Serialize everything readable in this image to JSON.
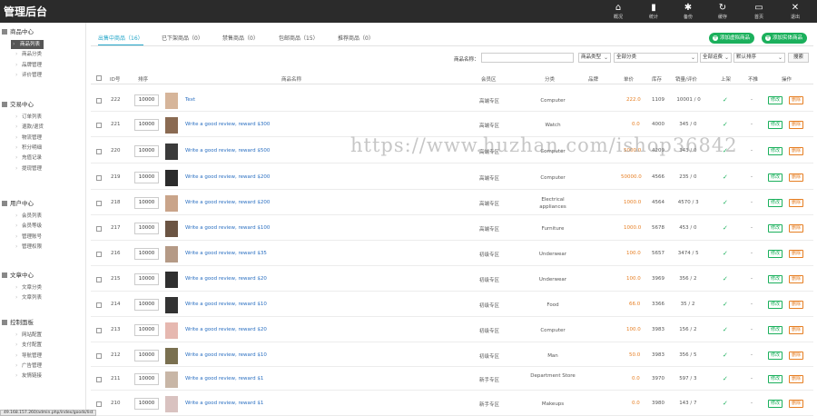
{
  "header": {
    "title": "管理后台",
    "nav": [
      {
        "icon": "home-icon",
        "glyph": "⌂",
        "label": "概况"
      },
      {
        "icon": "bar-chart-icon",
        "glyph": "▮",
        "label": "统计"
      },
      {
        "icon": "gear-icon",
        "glyph": "✱",
        "label": "备份"
      },
      {
        "icon": "refresh-icon",
        "glyph": "↻",
        "label": "缓存"
      },
      {
        "icon": "monitor-icon",
        "glyph": "▭",
        "label": "首页"
      },
      {
        "icon": "close-icon",
        "glyph": "✕",
        "label": "退出"
      }
    ]
  },
  "sidebar": {
    "sections": [
      {
        "title": "商品中心",
        "items": [
          "商品列表",
          "商品分类",
          "品牌管理",
          "评价管理"
        ]
      },
      {
        "title": "交易中心",
        "items": [
          "订单列表",
          "退款/退货",
          "物流管理",
          "积分明细",
          "充值记录",
          "提现管理"
        ]
      },
      {
        "title": "用户中心",
        "items": [
          "会员列表",
          "会员等级",
          "管理账号",
          "管理权限"
        ]
      },
      {
        "title": "文章中心",
        "items": [
          "文章分类",
          "文章列表"
        ]
      },
      {
        "title": "控制面板",
        "items": [
          "网站配置",
          "支付配置",
          "导航管理",
          "广告管理",
          "友情链接"
        ]
      }
    ],
    "active_item": "商品列表"
  },
  "tabs": [
    "出售中商品（16）",
    "已下架商品（0）",
    "禁售商品（0）",
    "包邮商品（15）",
    "推荐商品（0）"
  ],
  "buttons": {
    "add_virtual": "添加虚拟商品",
    "add_physical": "添加实体商品"
  },
  "filters": {
    "name_label": "商品名称：",
    "name_value": "",
    "type_select": "商品类型",
    "category_select": "全部分类",
    "ship_select": "全部运费",
    "sort_select": "默认排序",
    "search_button": "搜索"
  },
  "table": {
    "columns": [
      "ID号",
      "排序",
      "商品名称",
      "会员区",
      "分类",
      "品牌",
      "单价",
      "库存",
      "销量/评价",
      "上架",
      "不推",
      "操作"
    ],
    "edit_label": "修改",
    "delete_label": "删除",
    "rows": [
      {
        "id": "222",
        "sort": "10000",
        "title": "Text",
        "zone": "高端专区",
        "category": "Computer",
        "brand": "",
        "price": "222.0",
        "stock": "1109",
        "sales": "10001 / 0",
        "listed": "✓",
        "rec": "-",
        "thumb": "#d6b59a"
      },
      {
        "id": "221",
        "sort": "10000",
        "title": "Write a good review, reward $300",
        "zone": "高端专区",
        "category": "Watch",
        "brand": "",
        "price": "0.0",
        "stock": "4000",
        "sales": "345 / 0",
        "listed": "✓",
        "rec": "-",
        "thumb": "#8a6a52"
      },
      {
        "id": "220",
        "sort": "10000",
        "title": "Write a good review, reward $500",
        "zone": "高端专区",
        "category": "Computer",
        "brand": "",
        "price": "5000.0",
        "stock": "4209",
        "sales": "343 / 0",
        "listed": "✓",
        "rec": "-",
        "thumb": "#3a3a3a"
      },
      {
        "id": "219",
        "sort": "10000",
        "title": "Write a good review, reward $200",
        "zone": "高端专区",
        "category": "Computer",
        "brand": "",
        "price": "50000.0",
        "stock": "4566",
        "sales": "235 / 0",
        "listed": "✓",
        "rec": "-",
        "thumb": "#2b2b2b"
      },
      {
        "id": "218",
        "sort": "10000",
        "title": "Write a good review, reward $200",
        "zone": "高端专区",
        "category": "Electrical appliances",
        "brand": "",
        "price": "1000.0",
        "stock": "4564",
        "sales": "4570 / 3",
        "listed": "✓",
        "rec": "-",
        "thumb": "#c9a48a"
      },
      {
        "id": "217",
        "sort": "10000",
        "title": "Write a good review, reward $100",
        "zone": "高端专区",
        "category": "Furniture",
        "brand": "",
        "price": "1000.0",
        "stock": "5678",
        "sales": "453 / 0",
        "listed": "✓",
        "rec": "-",
        "thumb": "#6b5443"
      },
      {
        "id": "216",
        "sort": "10000",
        "title": "Write a good review, reward $35",
        "zone": "初级专区",
        "category": "Underwear",
        "brand": "",
        "price": "100.0",
        "stock": "5657",
        "sales": "3474 / 5",
        "listed": "✓",
        "rec": "-",
        "thumb": "#b59a86"
      },
      {
        "id": "215",
        "sort": "10000",
        "title": "Write a good review, reward $20",
        "zone": "初级专区",
        "category": "Underwear",
        "brand": "",
        "price": "100.0",
        "stock": "3969",
        "sales": "356 / 2",
        "listed": "✓",
        "rec": "-",
        "thumb": "#2f2f2f"
      },
      {
        "id": "214",
        "sort": "10000",
        "title": "Write a good review, reward $10",
        "zone": "初级专区",
        "category": "Food",
        "brand": "",
        "price": "66.0",
        "stock": "3366",
        "sales": "35 / 2",
        "listed": "✓",
        "rec": "-",
        "thumb": "#333333"
      },
      {
        "id": "213",
        "sort": "10000",
        "title": "Write a good review, reward $20",
        "zone": "初级专区",
        "category": "Computer",
        "brand": "",
        "price": "100.0",
        "stock": "3983",
        "sales": "156 / 2",
        "listed": "✓",
        "rec": "-",
        "thumb": "#e6b8b0"
      },
      {
        "id": "212",
        "sort": "10000",
        "title": "Write a good review, reward $10",
        "zone": "初级专区",
        "category": "Man",
        "brand": "",
        "price": "50.0",
        "stock": "3983",
        "sales": "356 / 5",
        "listed": "✓",
        "rec": "-",
        "thumb": "#7a7050"
      },
      {
        "id": "211",
        "sort": "10000",
        "title": "Write a good review, reward $1",
        "zone": "新手专区",
        "category": "Department Store",
        "brand": "",
        "price": "0.0",
        "stock": "3970",
        "sales": "597 / 3",
        "listed": "✓",
        "rec": "-",
        "thumb": "#c8b6a6"
      },
      {
        "id": "210",
        "sort": "10000",
        "title": "Write a good review, reward $1",
        "zone": "新手专区",
        "category": "Makeups",
        "brand": "",
        "price": "0.0",
        "stock": "3980",
        "sales": "143 / 7",
        "listed": "✓",
        "rec": "-",
        "thumb": "#d9c2c0"
      }
    ]
  },
  "watermark": "https://www.huzhan.com/ishop36842",
  "statusbar": "49.168.157.260/admin.php/index/goods/list"
}
